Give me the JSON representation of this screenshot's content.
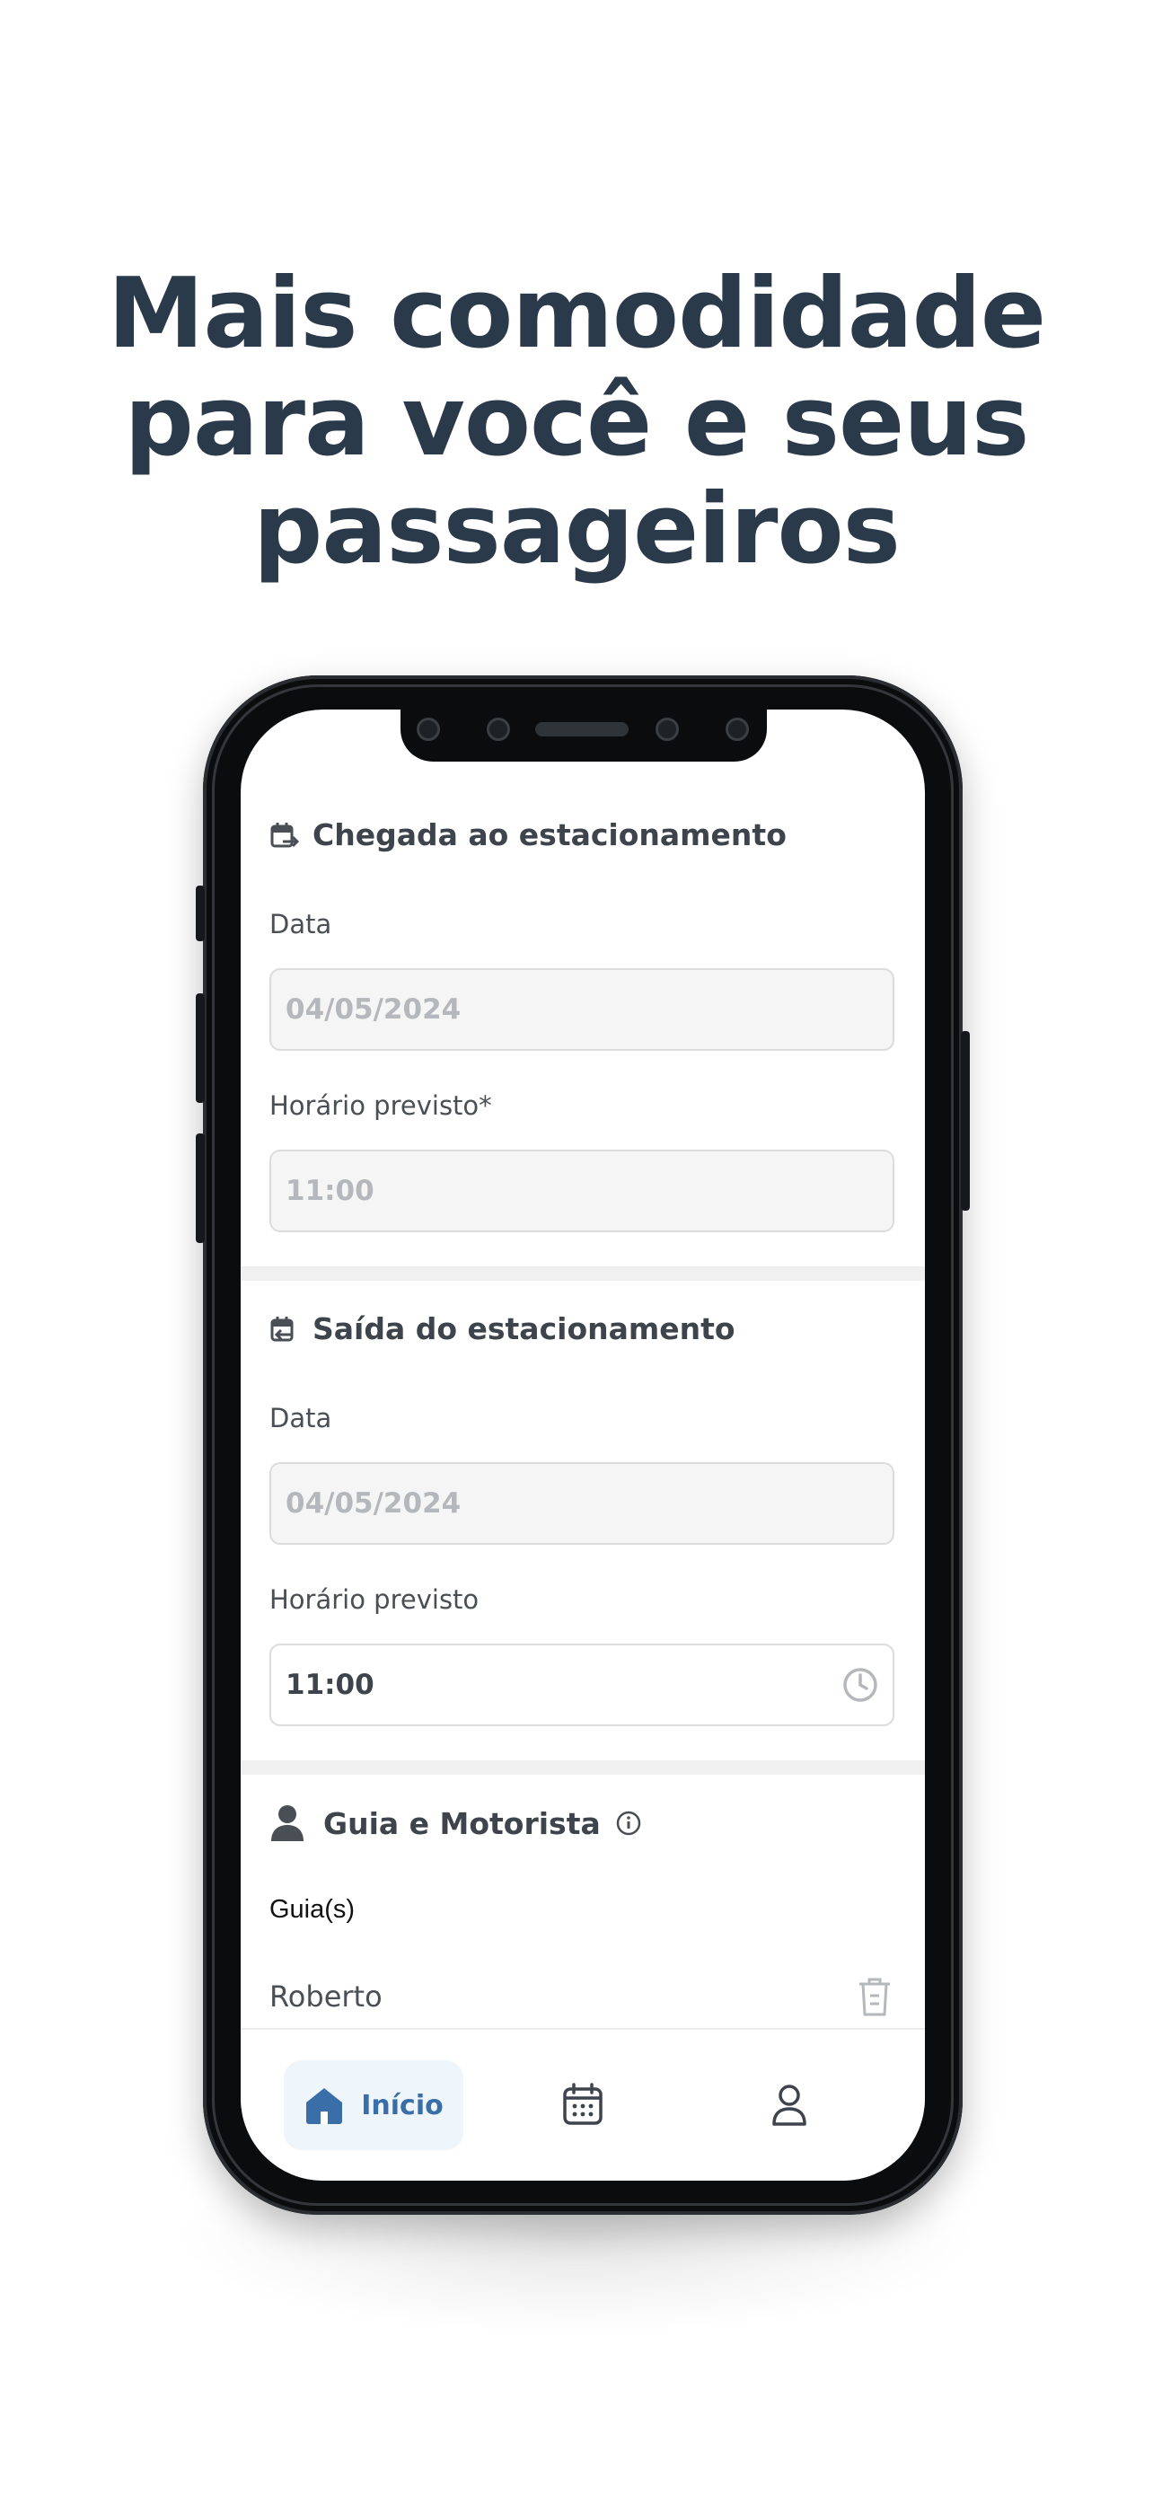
{
  "headline": {
    "line1": "Mais comodidade",
    "line2": "para você e seus",
    "line3": "passageiros"
  },
  "arrival": {
    "title": "Chegada ao estacionamento",
    "date_label": "Data",
    "date_value": "04/05/2024",
    "time_label": "Horário previsto*",
    "time_value": "11:00"
  },
  "departure": {
    "title": "Saída do estacionamento",
    "date_label": "Data",
    "date_value": "04/05/2024",
    "time_label": "Horário previsto",
    "time_value": "11:00"
  },
  "guide_driver": {
    "title": "Guia e Motorista",
    "guides_label": "Guia(s)",
    "guide_name": "Roberto"
  },
  "bottom_nav": {
    "home_label": "Início",
    "items": [
      "home-icon",
      "calendar-icon",
      "user-icon"
    ]
  },
  "colors": {
    "headline": "#2b3a4a",
    "accent": "#3a6ea8",
    "field_disabled_bg": "#f5f5f5"
  }
}
